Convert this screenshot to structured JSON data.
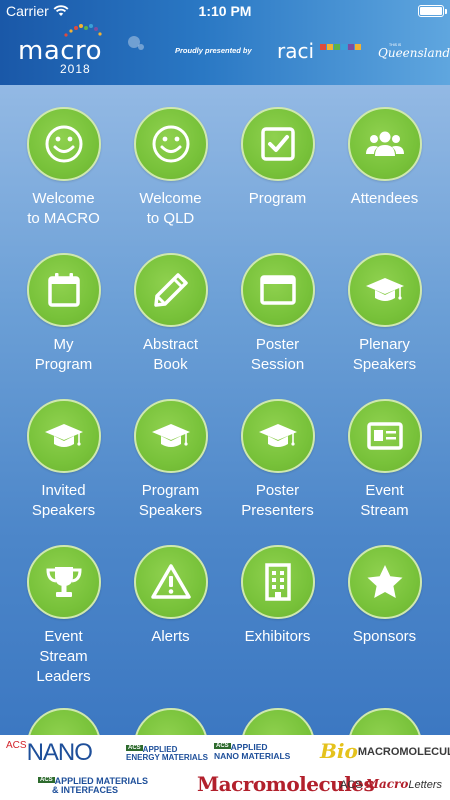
{
  "status_bar": {
    "carrier": "Carrier",
    "time": "1:10 PM"
  },
  "header": {
    "app_name": "macro",
    "year": "2018",
    "presented_by": "Proudly presented by",
    "raci_logo": "raci",
    "queensland_logo": "Queensland",
    "queensland_small": "THIS IS"
  },
  "tiles": [
    {
      "label": "Welcome\nto MACRO",
      "icon": "smiley-icon"
    },
    {
      "label": "Welcome\nto QLD",
      "icon": "smiley-icon"
    },
    {
      "label": "Program",
      "icon": "checkbox-icon"
    },
    {
      "label": "Attendees",
      "icon": "people-icon"
    },
    {
      "label": "My\nProgram",
      "icon": "calendar-icon"
    },
    {
      "label": "Abstract\nBook",
      "icon": "pencil-icon"
    },
    {
      "label": "Poster\nSession",
      "icon": "window-icon"
    },
    {
      "label": "Plenary\nSpeakers",
      "icon": "graduation-cap-icon"
    },
    {
      "label": "Invited\nSpeakers",
      "icon": "graduation-cap-icon"
    },
    {
      "label": "Program\nSpeakers",
      "icon": "graduation-cap-icon"
    },
    {
      "label": "Poster\nPresenters",
      "icon": "graduation-cap-icon"
    },
    {
      "label": "Event\nStream",
      "icon": "id-card-icon"
    },
    {
      "label": "Event\nStream\nLeaders",
      "icon": "trophy-icon"
    },
    {
      "label": "Alerts",
      "icon": "warning-icon"
    },
    {
      "label": "Exhibitors",
      "icon": "building-icon"
    },
    {
      "label": "Sponsors",
      "icon": "star-icon"
    }
  ],
  "sponsors": {
    "acs_nano": "NANO",
    "acs_prefix": "ACS",
    "applied_energy_line1": "APPLIED",
    "applied_energy_line2": "ENERGY MATERIALS",
    "applied_nano_line1": "APPLIED",
    "applied_nano_line2": "NANO MATERIALS",
    "bio_prefix": "Bio",
    "biomacromolecules": "MACROMOLECULES",
    "applied_mat_line1": "APPLIED MATERIALS",
    "applied_mat_line2": "& INTERFACES",
    "macromolecules": "Macromolecules",
    "macro_letters_prefix": "ACS",
    "macro_letters": "Macro",
    "letters": "Letters"
  },
  "colors": {
    "tile_green": "#78c23a",
    "header_blue": "#1a58a8",
    "background_top": "#93b9e4",
    "background_bottom": "#3c78c2"
  }
}
